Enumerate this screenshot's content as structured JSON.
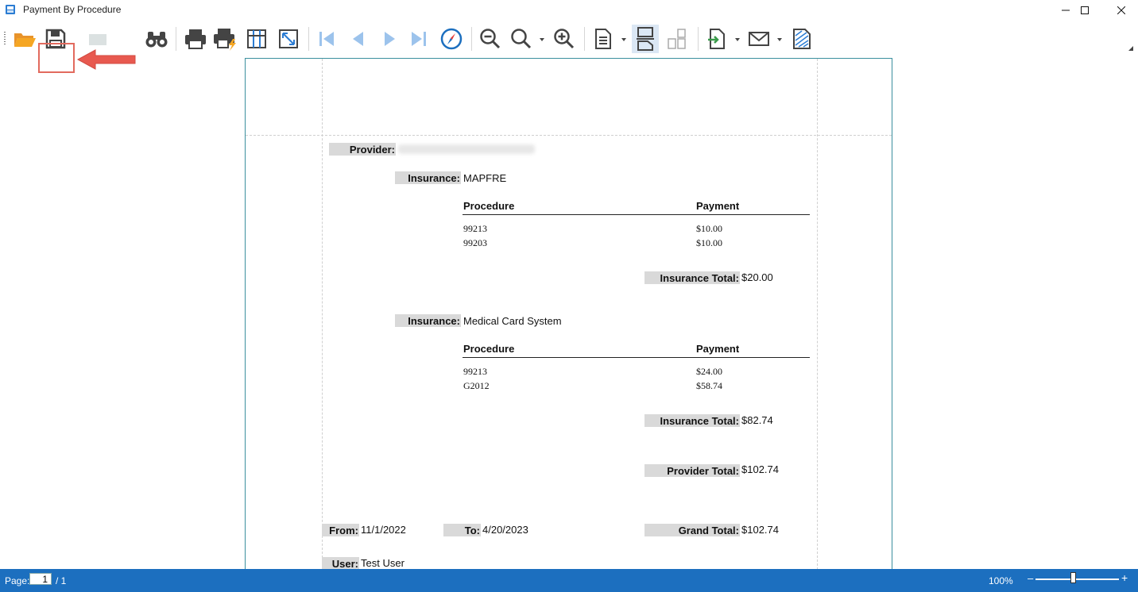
{
  "window": {
    "title": "Payment By Procedure"
  },
  "toolbar": {
    "buttons": [
      {
        "name": "open-icon"
      },
      {
        "name": "save-icon"
      },
      {
        "name": "export-page-icon"
      },
      {
        "name": "find-icon"
      },
      {
        "name": "print-icon"
      },
      {
        "name": "quick-print-icon"
      },
      {
        "name": "page-setup-icon"
      },
      {
        "name": "fit-page-icon"
      },
      {
        "name": "first-page-icon"
      },
      {
        "name": "previous-page-icon"
      },
      {
        "name": "next-page-icon"
      },
      {
        "name": "last-page-icon"
      },
      {
        "name": "navigation-compass-icon"
      },
      {
        "name": "zoom-out-icon"
      },
      {
        "name": "zoom-icon"
      },
      {
        "name": "zoom-in-icon"
      },
      {
        "name": "single-page-icon"
      },
      {
        "name": "continuous-page-icon"
      },
      {
        "name": "multi-page-icon"
      },
      {
        "name": "export-icon"
      },
      {
        "name": "email-icon"
      },
      {
        "name": "watermark-icon"
      }
    ],
    "colors": {
      "accent_red": "#e26a5e",
      "folder": "#f5a623",
      "nav_disabled": "#9cc3ec",
      "nav_compass": "#1c6fbf"
    }
  },
  "report": {
    "provider": {
      "label": "Provider:",
      "value_redacted": true
    },
    "groups": [
      {
        "insurance_label": "Insurance:",
        "insurance_name": "MAPFRE",
        "col_procedure": "Procedure",
        "col_payment": "Payment",
        "rows": [
          {
            "procedure": "99213",
            "payment": "$10.00"
          },
          {
            "procedure": "99203",
            "payment": "$10.00"
          }
        ],
        "total_label": "Insurance Total:",
        "total_value": "$20.00"
      },
      {
        "insurance_label": "Insurance:",
        "insurance_name": "Medical Card System",
        "col_procedure": "Procedure",
        "col_payment": "Payment",
        "rows": [
          {
            "procedure": "99213",
            "payment": "$24.00"
          },
          {
            "procedure": "G2012",
            "payment": "$58.74"
          }
        ],
        "total_label": "Insurance Total:",
        "total_value": "$82.74"
      }
    ],
    "provider_total_label": "Provider Total:",
    "provider_total_value": "$102.74",
    "from_label": "From:",
    "from_value": "11/1/2022",
    "to_label": "To:",
    "to_value": "4/20/2023",
    "grand_total_label": "Grand Total:",
    "grand_total_value": "$102.74",
    "user_label": "User:",
    "user_value": "Test User"
  },
  "statusbar": {
    "page_label": "Page:",
    "page_current": "1",
    "page_total": "/ 1",
    "zoom": "100%",
    "zoom_level_percent": 100,
    "background": "#1c6fbf"
  }
}
